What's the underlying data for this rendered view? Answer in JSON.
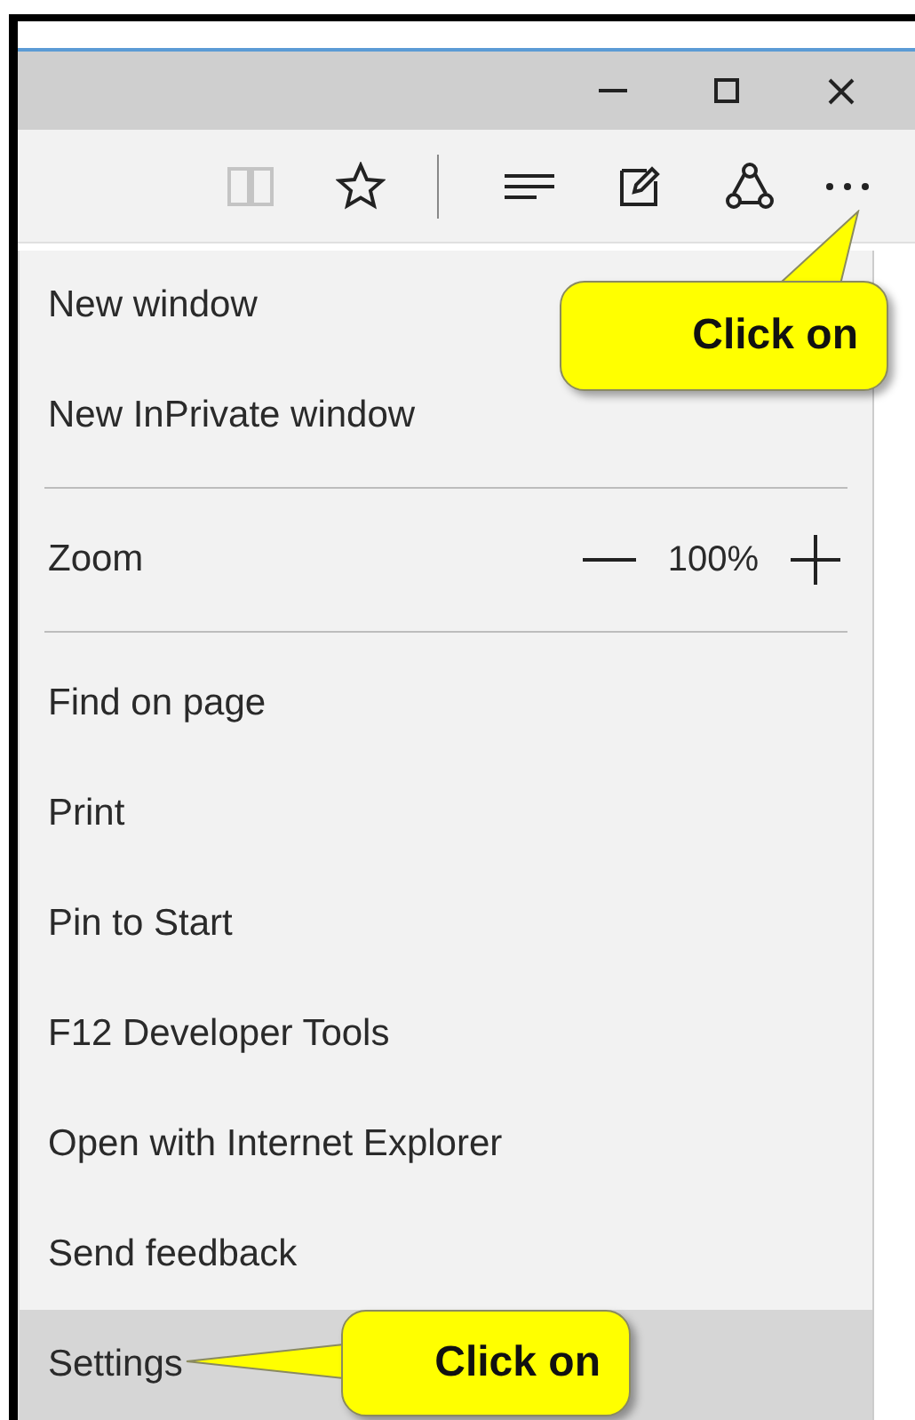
{
  "title_bar": {
    "buttons": [
      {
        "kind": "minimize"
      },
      {
        "kind": "maximize"
      },
      {
        "kind": "close"
      }
    ]
  },
  "toolbar": {
    "groups": [
      [
        {
          "kind": "reading",
          "disabled": true
        },
        {
          "kind": "star",
          "disabled": false
        }
      ],
      [
        {
          "kind": "hub",
          "disabled": false
        },
        {
          "kind": "note",
          "disabled": false
        },
        {
          "kind": "share",
          "disabled": false
        },
        {
          "kind": "more",
          "disabled": false
        }
      ]
    ]
  },
  "menu": {
    "sections": [
      [
        {
          "kind": "item",
          "label": "New window",
          "selected": false
        },
        {
          "kind": "item",
          "label": "New InPrivate window",
          "selected": false
        }
      ],
      [
        {
          "kind": "zoom",
          "label": "Zoom",
          "value": "100%"
        }
      ],
      [
        {
          "kind": "item",
          "label": "Find on page",
          "selected": false
        },
        {
          "kind": "item",
          "label": "Print",
          "selected": false
        },
        {
          "kind": "item",
          "label": "Pin to Start",
          "selected": false
        },
        {
          "kind": "item",
          "label": "F12 Developer Tools",
          "selected": false
        },
        {
          "kind": "item",
          "label": "Open with Internet Explorer",
          "selected": false
        },
        {
          "kind": "item",
          "label": "Send feedback",
          "selected": false
        },
        {
          "kind": "item",
          "label": "Settings",
          "selected": true
        }
      ]
    ]
  },
  "callouts": [
    {
      "text": "Click on"
    },
    {
      "text": "Click on"
    }
  ]
}
